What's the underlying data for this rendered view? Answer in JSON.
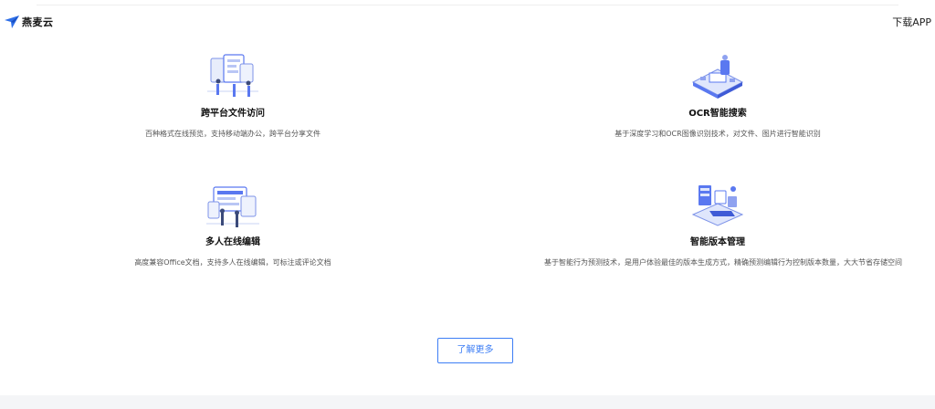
{
  "header": {
    "brand": "燕麦云",
    "download_label": "下载APP"
  },
  "features": [
    {
      "title": "跨平台文件访问",
      "desc": "百种格式在线预览，支持移动端办公，跨平台分享文件",
      "icon": "cross-platform-illustration"
    },
    {
      "title": "OCR智能搜索",
      "desc": "基于深度学习和OCR图像识别技术，对文件、图片进行智能识别",
      "icon": "ocr-search-illustration"
    },
    {
      "title": "多人在线编辑",
      "desc": "高度兼容Office文档，支持多人在线编辑，可标注或评论文档",
      "icon": "collaborative-editing-illustration"
    },
    {
      "title": "智能版本管理",
      "desc": "基于智能行为预测技术，是用户体验最佳的版本生成方式，精确预测编辑行为控制版本数量，大大节省存储空间",
      "icon": "version-management-illustration"
    }
  ],
  "more_button": "了解更多",
  "colors": {
    "accent": "#3d7ef5",
    "illustration": "#5a78f0",
    "footer": "#f4f5f7"
  }
}
